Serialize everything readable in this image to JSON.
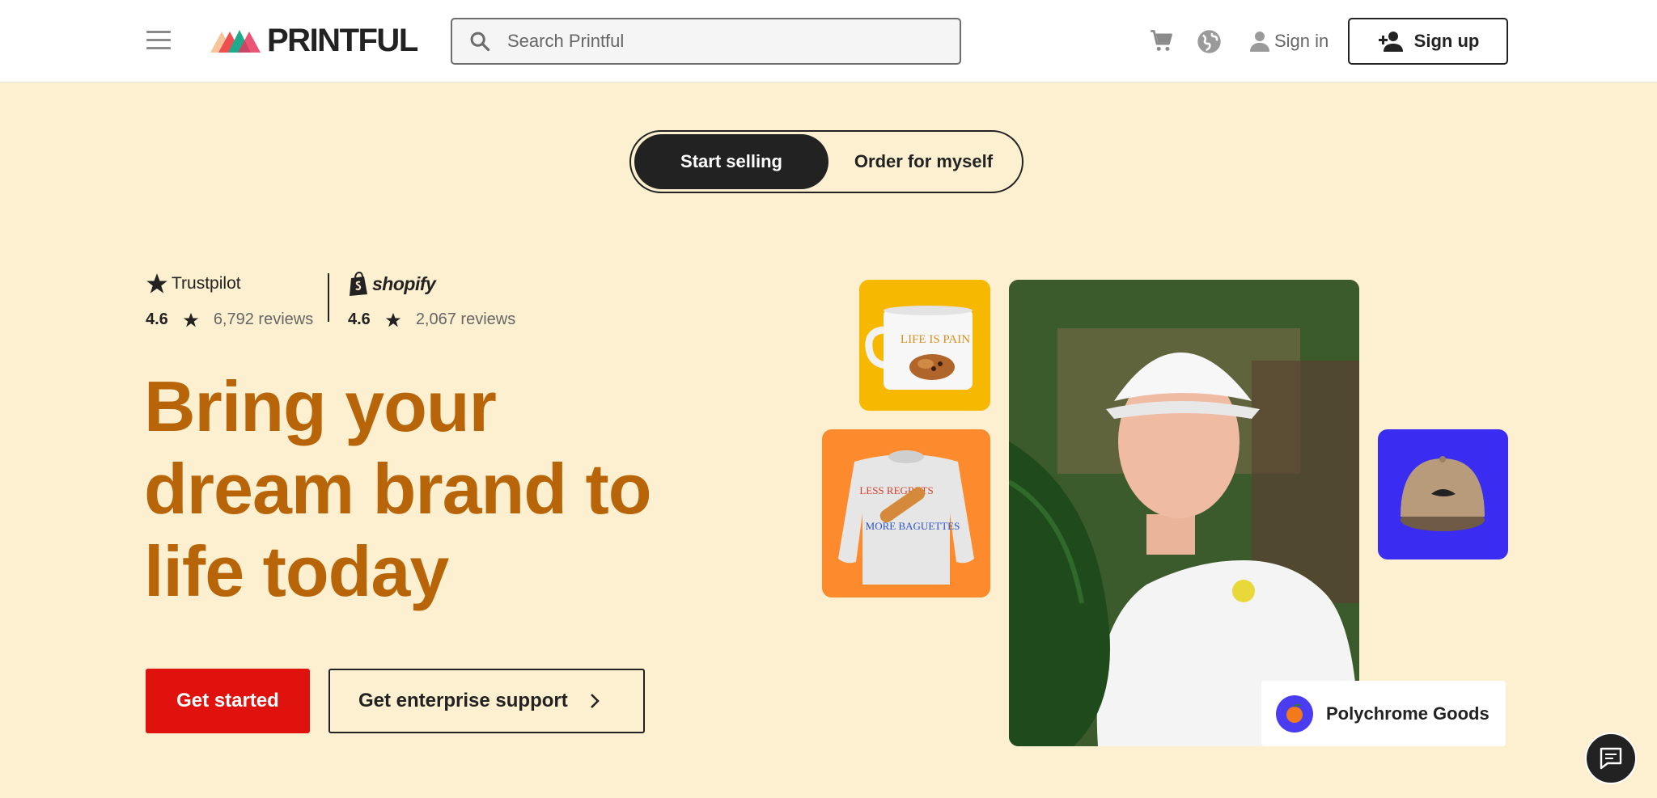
{
  "header": {
    "logo_text": "PRINTFUL",
    "search_placeholder": "Search Printful",
    "signin_label": "Sign in",
    "signup_label": "Sign up"
  },
  "toggle": {
    "options": [
      {
        "label": "Start selling",
        "active": true
      },
      {
        "label": "Order for myself",
        "active": false
      }
    ]
  },
  "ratings": {
    "trustpilot": {
      "name": "Trustpilot",
      "score": "4.6",
      "reviews": "6,792 reviews"
    },
    "shopify": {
      "name": "shopify",
      "score": "4.6",
      "reviews": "2,067 reviews"
    }
  },
  "hero": {
    "headline_lines": [
      "Bring your",
      "dream brand to",
      "life today"
    ],
    "primary_cta": "Get started",
    "secondary_cta": "Get enterprise support"
  },
  "collage": {
    "mug_text": "LIFE IS PAIN",
    "sweatshirt_text_top": "LESS REGRETS",
    "sweatshirt_text_bottom": "MORE BAGUETTES",
    "brand_card_label": "Polychrome Goods"
  },
  "colors": {
    "background": "#fdf0d0",
    "headline": "#b8650a",
    "primary_cta": "#e0120e",
    "mug_tile": "#f6b800",
    "sweatshirt_tile": "#fd8a2d",
    "cap_tile": "#3a2cf0"
  },
  "icons": [
    "menu-icon",
    "search-icon",
    "cart-icon",
    "globe-icon",
    "user-icon",
    "add-user-icon",
    "star-icon",
    "chevron-right-icon",
    "chat-icon"
  ]
}
